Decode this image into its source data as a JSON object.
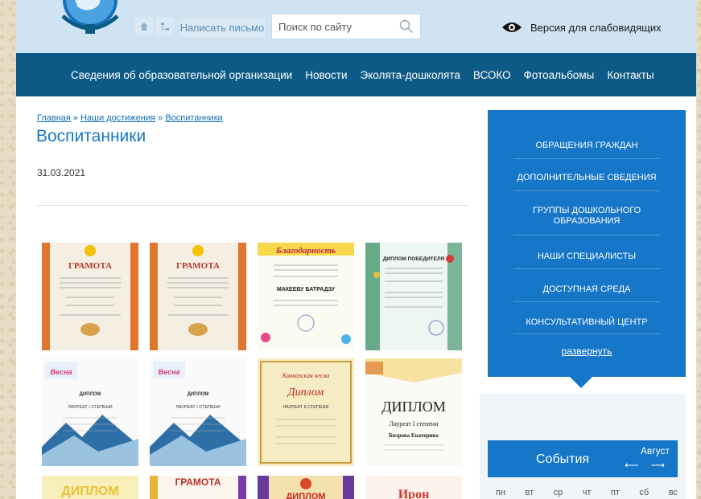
{
  "header": {
    "write_label": "Написать письмо",
    "search_placeholder": "Поиск по сайту",
    "accessible_label": "Версия для слабовидящих"
  },
  "nav": {
    "items": [
      "Сведения об образовательной организации",
      "Новости",
      "Эколята-дошколята",
      "ВСОКО",
      "Фотоальбомы",
      "Контакты"
    ]
  },
  "breadcrumb": {
    "home": "Главная",
    "sep": " » ",
    "section": "Наши достижения",
    "current": "Воспитанники"
  },
  "page": {
    "title": "Воспитанники",
    "date": "31.03.2021"
  },
  "gallery": {
    "items": [
      {
        "heading": "ГРАМОТА",
        "name": ""
      },
      {
        "heading": "ГРАМОТА",
        "name": ""
      },
      {
        "heading": "Благодарность",
        "name": "МАКЕЕВУ БАТРАДЗУ"
      },
      {
        "heading": "ДИПЛОМ ПОБЕДИТЕЛЯ",
        "name": ""
      },
      {
        "heading": "ДИПЛОМ",
        "sub": "ЛАУРЕАТ I СТЕПЕНИ"
      },
      {
        "heading": "ДИПЛОМ",
        "sub": "ЛАУРЕАТ I СТЕПЕНИ"
      },
      {
        "heading": "Диплом",
        "sub": "ЛАУРЕАТ II СТЕПЕНИ",
        "banner": "Кавказская весна"
      },
      {
        "heading": "ДИПЛОМ",
        "sub": "Лауреат I степени",
        "name": "Бизрова Екатерина"
      },
      {
        "heading": "ДИПЛОМ"
      },
      {
        "heading": "ГРАМОТА"
      },
      {
        "heading": "ДИПЛОМ"
      },
      {
        "heading": "Ирон"
      }
    ]
  },
  "sidebar": {
    "items": [
      "Обращения граждан",
      "Дополнительные сведения",
      "Группы дошкольного образования",
      "Наши специалисты",
      "Доступная среда",
      "Консультативный центр"
    ],
    "expand_label": "развернуть"
  },
  "events": {
    "title": "События",
    "month": "Август",
    "arrows": "⟵ ⟶",
    "weekdays": [
      "пн",
      "вт",
      "ср",
      "чт",
      "пт",
      "сб",
      "вс"
    ]
  },
  "colors": {
    "nav_bg": "#0e5a86",
    "sidebar_bg": "#1676c8",
    "link": "#0e6db5"
  }
}
